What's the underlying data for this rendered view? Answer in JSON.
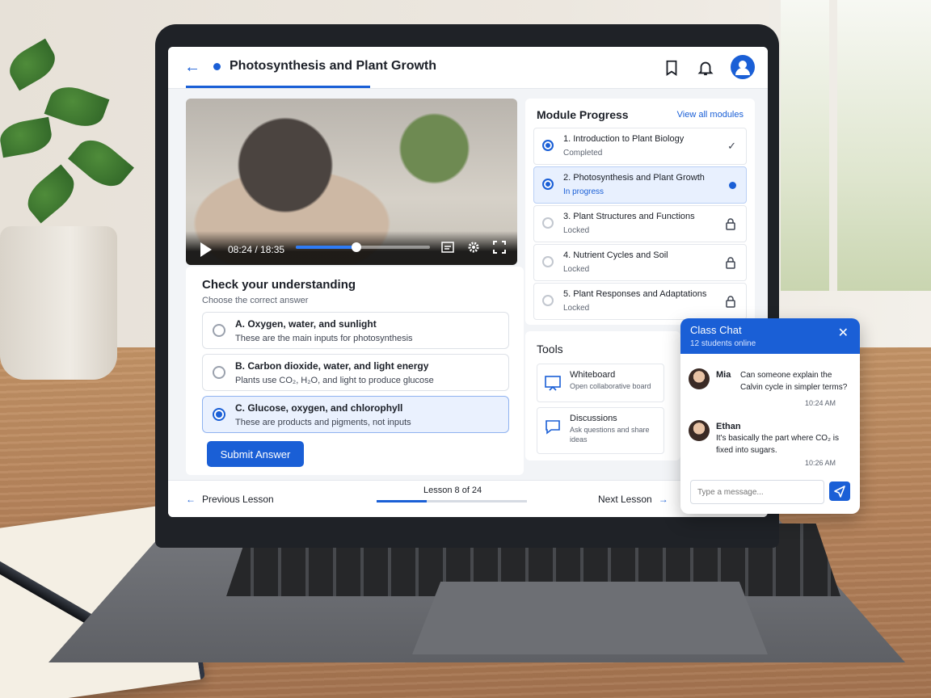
{
  "header": {
    "course_title": "Photosynthesis and Plant Growth",
    "icons": [
      "back-arrow-icon",
      "bookmark-icon",
      "bell-icon",
      "user-avatar-icon"
    ]
  },
  "video": {
    "current_time": "08:24",
    "duration": "18:35",
    "time_display": "08:24 / 18:35",
    "progress_fraction": 0.45,
    "icons": [
      "play-icon",
      "captions-icon",
      "settings-icon",
      "fullscreen-icon"
    ]
  },
  "quiz": {
    "title": "Check your understanding",
    "subtitle": "Choose the correct answer",
    "options": [
      {
        "label": "A. Oxygen, water, and sunlight",
        "desc": "These are the main inputs for photosynthesis",
        "selected": false
      },
      {
        "label": "B. Carbon dioxide, water, and light energy",
        "desc": "Plants use CO₂, H₂O, and light to produce glucose",
        "selected": false
      },
      {
        "label": "C. Glucose, oxygen, and chlorophyll",
        "desc": "These are products and pigments, not inputs",
        "selected": true
      }
    ],
    "submit_label": "Submit Answer"
  },
  "module_progress": {
    "title": "Module Progress",
    "view_all": "View all modules",
    "modules": [
      {
        "name": "1. Introduction to Plant Biology",
        "status": "Completed",
        "state": "completed"
      },
      {
        "name": "2. Photosynthesis and Plant Growth",
        "status": "In progress",
        "state": "active"
      },
      {
        "name": "3. Plant Structures and Functions",
        "status": "Locked",
        "state": "locked"
      },
      {
        "name": "4. Nutrient Cycles and Soil",
        "status": "Locked",
        "state": "locked"
      },
      {
        "name": "5. Plant Responses and Adaptations",
        "status": "Locked",
        "state": "locked"
      }
    ]
  },
  "tools": {
    "title": "Tools",
    "items": [
      {
        "name": "Whiteboard",
        "desc": "Open collaborative board",
        "icon": "whiteboard-icon"
      },
      {
        "name": "Discussions",
        "desc": "Ask questions and share ideas",
        "icon": "chat-bubble-icon"
      }
    ]
  },
  "footer": {
    "previous": "Previous Lesson",
    "lesson_counter": "Lesson 8 of 24",
    "lesson_fraction": 0.333,
    "next": "Next Lesson"
  },
  "chat": {
    "title": "Class Chat",
    "online": "12 students online",
    "messages": [
      {
        "name": "Mia",
        "text": "Can someone explain the Calvin cycle in simpler terms?",
        "time": "10:24 AM"
      },
      {
        "name": "Ethan",
        "text": "It's basically the part where CO₂ is fixed into sugars.",
        "time": "10:26 AM"
      }
    ],
    "input_placeholder": "Type a message..."
  },
  "colors": {
    "accent": "#1a5fd6",
    "selected_bg": "#eaf1fe"
  }
}
